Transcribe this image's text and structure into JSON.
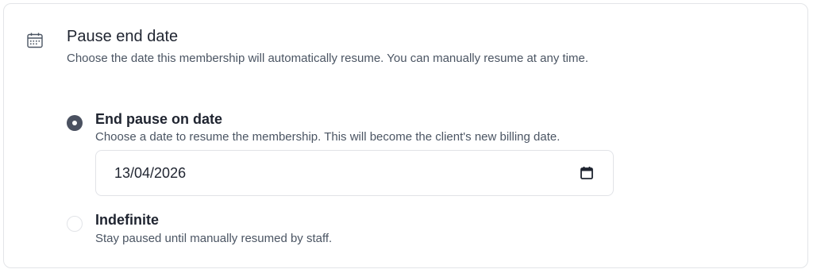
{
  "section": {
    "icon": "calendar-icon",
    "title": "Pause end date",
    "subtitle": "Choose the date this membership will automatically resume. You can manually resume at any time."
  },
  "options": [
    {
      "label": "End pause on date",
      "description": "Choose a date to resume the membership. This will become the client's new billing date.",
      "selected": true
    },
    {
      "label": "Indefinite",
      "description": "Stay paused until manually resumed by staff.",
      "selected": false
    }
  ],
  "date_input": {
    "value": "13/04/2026",
    "icon": "calendar-picker-icon"
  },
  "colors": {
    "radio_selected": "#4a5160",
    "border": "#e3e5e8",
    "muted_text": "#4b5563"
  }
}
